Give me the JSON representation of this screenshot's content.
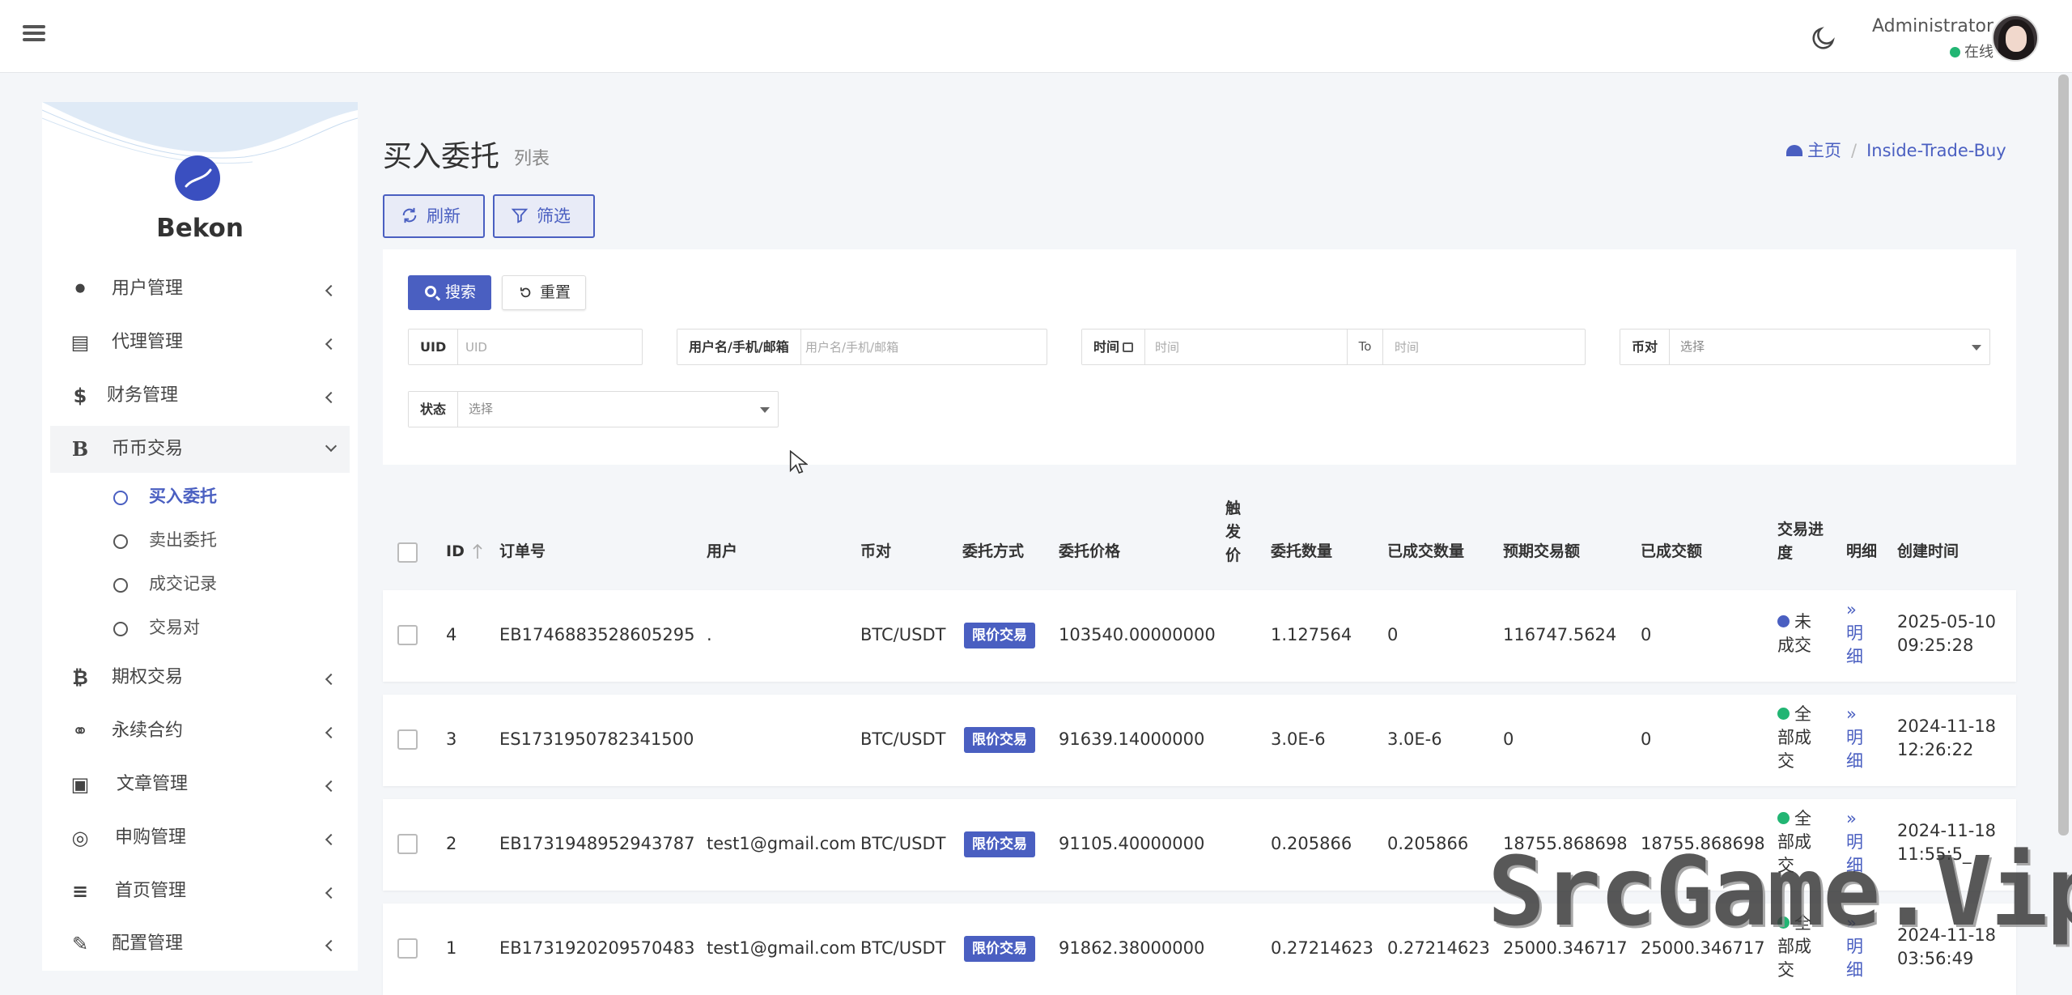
{
  "header": {
    "admin_name": "Administrator",
    "admin_status": "在线",
    "status_color": "#22b573",
    "icons": [
      "hamburger-menu-icon",
      "moon-icon"
    ]
  },
  "sidebar": {
    "brand": "Bekon",
    "items": [
      {
        "label": "用户管理",
        "icon": "user-icon"
      },
      {
        "label": "代理管理",
        "icon": "id-card-icon"
      },
      {
        "label": "财务管理",
        "icon": "dollar-icon"
      },
      {
        "label": "币币交易",
        "icon": "bold-b-icon"
      },
      {
        "label": "期权交易",
        "icon": "bitcoin-icon"
      },
      {
        "label": "永续合约",
        "icon": "link-icon"
      },
      {
        "label": "文章管理",
        "icon": "newspaper-icon"
      },
      {
        "label": "申购管理",
        "icon": "life-ring-icon"
      },
      {
        "label": "首页管理",
        "icon": "list-icon"
      },
      {
        "label": "配置管理",
        "icon": "wrench-icon"
      }
    ],
    "subitems": [
      {
        "label": "买入委托",
        "active": true
      },
      {
        "label": "卖出委托"
      },
      {
        "label": "成交记录"
      },
      {
        "label": "交易对"
      }
    ],
    "icon_glyphs": {
      "user": "&#x1F464;",
      "id": "▤",
      "dollar": "$",
      "b": "B",
      "btc": "₿",
      "link": "⚭",
      "news": "▣",
      "ring": "◎",
      "list": "≡",
      "wrench": "✎"
    }
  },
  "page": {
    "title": "买入委托",
    "subtitle": "列表",
    "breadcrumb_home": "主页",
    "breadcrumb_sep": "/",
    "breadcrumb_current": "Inside-Trade-Buy",
    "refresh_label": "刷新",
    "filter_label": "筛选",
    "accent": "#4a5fc1"
  },
  "filters": {
    "search_label": "搜索",
    "reset_label": "重置",
    "uid_label": "UID",
    "uid_placeholder": "UID",
    "user_label": "用户名/手机/邮箱",
    "user_placeholder": "用户名/手机/邮箱",
    "time_label": "时间",
    "time_placeholder": "时间",
    "to_label": "To",
    "pair_label": "币对",
    "pair_placeholder": "选择",
    "status_label": "状态",
    "status_placeholder": "选择"
  },
  "table": {
    "columns": {
      "id": "ID",
      "order_no": "订单号",
      "user": "用户",
      "pair": "币对",
      "method": "委托方式",
      "price": "委托价格",
      "trigger": "触发价",
      "qty": "委托数量",
      "filled_qty": "已成交数量",
      "expected": "预期交易额",
      "filled_amt": "已成交额",
      "progress": "交易进度",
      "detail": "明细",
      "created": "创建时间"
    },
    "detail_label": "» 明细",
    "rows": [
      {
        "id": "4",
        "order_no": "EB1746883528605295",
        "user": ".",
        "pair": "BTC/USDT",
        "method": "限价交易",
        "price": "103540.00000000",
        "trigger": "",
        "qty": "1.127564",
        "filled_qty": "0",
        "expected": "116747.5624",
        "filled_amt": "0",
        "progress": "未成交",
        "progress_color": "#4a5fc1",
        "created_date": "2025-05-10",
        "created_time": "09:25:28"
      },
      {
        "id": "3",
        "order_no": "ES1731950782341500",
        "user": "",
        "pair": "BTC/USDT",
        "method": "限价交易",
        "price": "91639.14000000",
        "trigger": "",
        "qty": "3.0E-6",
        "filled_qty": "3.0E-6",
        "expected": "0",
        "filled_amt": "0",
        "progress": "全部成交",
        "progress_color": "#22b573",
        "created_date": "2024-11-18",
        "created_time": "12:26:22"
      },
      {
        "id": "2",
        "order_no": "EB1731948952943787",
        "user": "test1@gmail.com",
        "pair": "BTC/USDT",
        "method": "限价交易",
        "price": "91105.40000000",
        "trigger": "",
        "qty": "0.205866",
        "filled_qty": "0.205866",
        "expected": "18755.868698",
        "filled_amt": "18755.868698",
        "progress": "全部成交",
        "progress_color": "#22b573",
        "created_date": "2024-11-18",
        "created_time": "11:55:5_"
      },
      {
        "id": "1",
        "order_no": "EB1731920209570483",
        "user": "test1@gmail.com",
        "pair": "BTC/USDT",
        "method": "限价交易",
        "price": "91862.38000000",
        "trigger": "",
        "qty": "0.27214623",
        "filled_qty": "0.27214623",
        "expected": "25000.346717",
        "filled_amt": "25000.346717",
        "progress": "全部成交",
        "progress_color": "#22b573",
        "created_date": "2024-11-18",
        "created_time": "03:56:49"
      }
    ]
  },
  "watermark": "SrcGame.Vip"
}
